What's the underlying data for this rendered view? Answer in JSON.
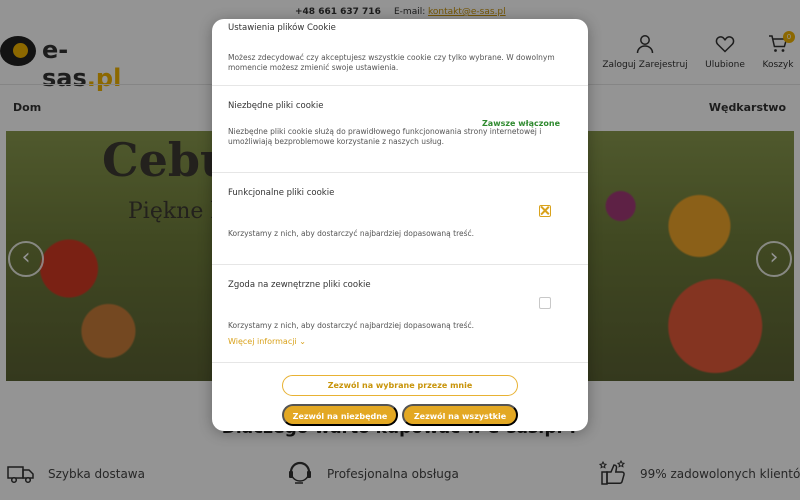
{
  "topbar": {
    "phone": "+48 661 637 716",
    "email_label": "E-mail:",
    "email": "kontakt@e-sas.pl"
  },
  "logo": {
    "text_main": "e-sas",
    "text_suffix": ".pl"
  },
  "header": {
    "login_label": "Zaloguj Zarejestruj",
    "favorites_label": "Ulubione",
    "cart_label": "Koszyk",
    "cart_count": "0"
  },
  "nav": {
    "left_item": "Dom",
    "right_item": "Wędkarstwo"
  },
  "hero": {
    "title": "Cebu",
    "subtitle": "Piękne k"
  },
  "why": {
    "title": "Dlaczego warto kupować w e-sas.pl ?"
  },
  "features": [
    {
      "icon": "truck-icon",
      "label": "Szybka dostawa"
    },
    {
      "icon": "support-icon",
      "label": "Profesjonalna obsługa"
    },
    {
      "icon": "thumbs-up-icon",
      "label": "99% zadowolonych klientów"
    }
  ],
  "cookie_modal": {
    "title": "Ustawienia plików Cookie",
    "intro": "Możesz zdecydować czy akceptujesz wszystkie cookie czy tylko wybrane. W dowolnym momencie możesz zmienić swoje ustawienia.",
    "sections": [
      {
        "title": "Niezbędne pliki cookie",
        "status": "Zawsze włączone",
        "description": "Niezbędne pliki cookie służą do prawidłowego funkcjonowania strony internetowej i umożliwiają bezproblemowe korzystanie z naszych usług."
      },
      {
        "title": "Funkcjonalne pliki cookie",
        "checked": true,
        "description": "Korzystamy z nich, aby dostarczyć najbardziej dopasowaną treść."
      },
      {
        "title": "Zgoda na zewnętrzne pliki cookie",
        "checked": false,
        "description": "Korzystamy z nich, aby dostarczyć najbardziej dopasowaną treść.",
        "more_link": "Więcej informacji ⌄"
      }
    ],
    "buttons": {
      "allow_selected": "Zezwól na wybrane przeze mnie",
      "allow_necessary": "Zezwól na niezbędne",
      "allow_all": "Zezwól na wszystkie"
    }
  },
  "colors": {
    "accent": "#e3a823",
    "accent_text": "#c8940a",
    "always_on": "#2f8a2f"
  }
}
